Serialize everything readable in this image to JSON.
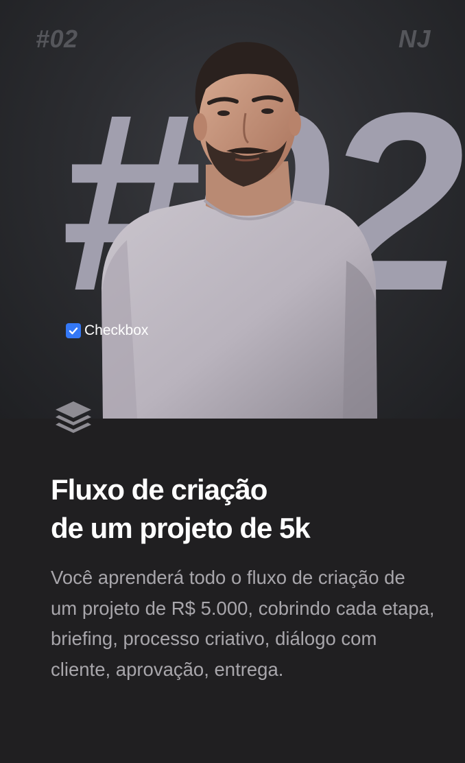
{
  "hero": {
    "corner_left": "#02",
    "corner_right": "NJ",
    "big_number": "#02",
    "checkbox": {
      "label": "Checkbox",
      "checked": true
    },
    "icons": {
      "checkbox": "checkmark-icon",
      "stack": "layers-stack-icon"
    }
  },
  "content": {
    "title_lines": [
      "Fluxo de criação",
      "de um projeto de 5k"
    ],
    "description": "Você aprenderá todo o fluxo de criação de um projeto de R$ 5.000, cobrindo cada etapa, briefing, processo criativo, diálogo com cliente, aprovação, entrega."
  },
  "colors": {
    "background": "#201f21",
    "big_number": "#a19fae",
    "title": "#ffffff",
    "description": "#a8a6ab",
    "checkbox_accent": "#3478f6"
  }
}
